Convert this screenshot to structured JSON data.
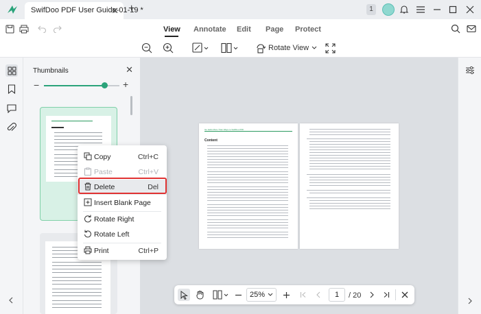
{
  "titlebar": {
    "document_tab_title": "SwifDoo PDF User Guide-01-19 *",
    "notification_count": "1"
  },
  "menubar": {
    "tabs": [
      {
        "label": "View",
        "active": true
      },
      {
        "label": "Annotate",
        "active": false
      },
      {
        "label": "Edit",
        "active": false
      },
      {
        "label": "Page",
        "active": false
      },
      {
        "label": "Protect",
        "active": false
      }
    ]
  },
  "toolbar": {
    "rotate_view_label": "Rotate View"
  },
  "thumbnails_panel": {
    "title": "Thumbnails",
    "zoom_level": 0.8
  },
  "document_page": {
    "header_link": "Go Hello More Than Ways to SwifDoo PDF",
    "heading": "Content"
  },
  "navigation": {
    "zoom": "25%",
    "current_page": "1",
    "total_pages": "/ 20"
  },
  "context_menu": {
    "items": [
      {
        "label": "Copy",
        "shortcut": "Ctrl+C",
        "icon": "copy-icon",
        "enabled": true
      },
      {
        "label": "Paste",
        "shortcut": "Ctrl+V",
        "icon": "paste-icon",
        "enabled": false
      },
      {
        "label": "Delete",
        "shortcut": "Del",
        "icon": "trash-icon",
        "enabled": true
      },
      {
        "label": "Insert Blank Page",
        "shortcut": "",
        "icon": "insert-page-icon",
        "enabled": true
      },
      {
        "label": "Rotate Right",
        "shortcut": "",
        "icon": "rotate-right-icon",
        "enabled": true
      },
      {
        "label": "Rotate Left",
        "shortcut": "",
        "icon": "rotate-left-icon",
        "enabled": true
      },
      {
        "label": "Print",
        "shortcut": "Ctrl+P",
        "icon": "print-icon",
        "enabled": true
      }
    ]
  },
  "colors": {
    "accent_green": "#2aa37a",
    "highlight_red": "#e03131",
    "selected_thumb_bg": "#d8f1e6"
  }
}
